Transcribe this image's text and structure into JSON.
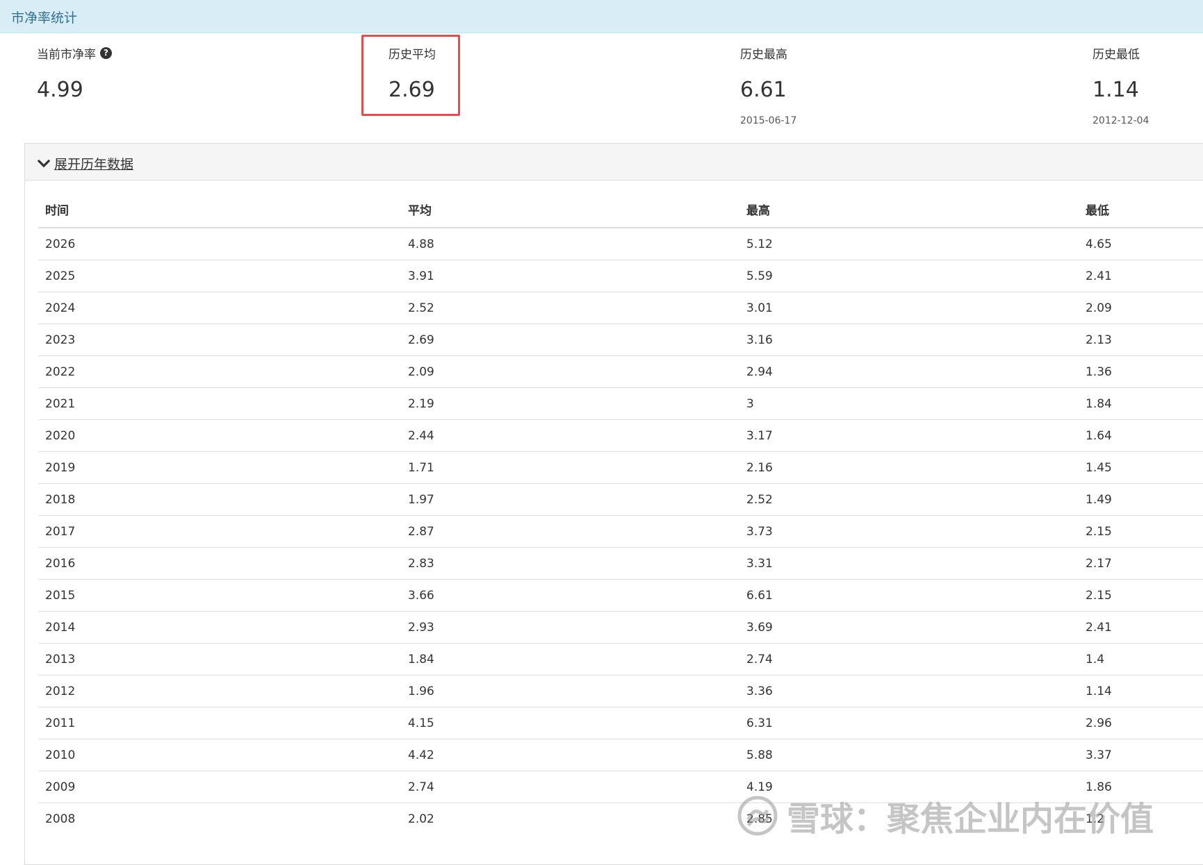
{
  "panel": {
    "title": "市净率统计"
  },
  "stats": {
    "current": {
      "label": "当前市净率",
      "value": "4.99"
    },
    "average": {
      "label": "历史平均",
      "value": "2.69"
    },
    "highest": {
      "label": "历史最高",
      "value": "6.61",
      "date": "2015-06-17"
    },
    "lowest": {
      "label": "历史最低",
      "value": "1.14",
      "date": "2012-12-04"
    }
  },
  "history": {
    "toggle_label": "展开历年数据",
    "columns": [
      "时间",
      "平均",
      "最高",
      "最低"
    ],
    "rows": [
      [
        "2026",
        "4.88",
        "5.12",
        "4.65"
      ],
      [
        "2025",
        "3.91",
        "5.59",
        "2.41"
      ],
      [
        "2024",
        "2.52",
        "3.01",
        "2.09"
      ],
      [
        "2023",
        "2.69",
        "3.16",
        "2.13"
      ],
      [
        "2022",
        "2.09",
        "2.94",
        "1.36"
      ],
      [
        "2021",
        "2.19",
        "3",
        "1.84"
      ],
      [
        "2020",
        "2.44",
        "3.17",
        "1.64"
      ],
      [
        "2019",
        "1.71",
        "2.16",
        "1.45"
      ],
      [
        "2018",
        "1.97",
        "2.52",
        "1.49"
      ],
      [
        "2017",
        "2.87",
        "3.73",
        "2.15"
      ],
      [
        "2016",
        "2.83",
        "3.31",
        "2.17"
      ],
      [
        "2015",
        "3.66",
        "6.61",
        "2.15"
      ],
      [
        "2014",
        "2.93",
        "3.69",
        "2.41"
      ],
      [
        "2013",
        "1.84",
        "2.74",
        "1.4"
      ],
      [
        "2012",
        "1.96",
        "3.36",
        "1.14"
      ],
      [
        "2011",
        "4.15",
        "6.31",
        "2.96"
      ],
      [
        "2010",
        "4.42",
        "5.88",
        "3.37"
      ],
      [
        "2009",
        "2.74",
        "4.19",
        "1.86"
      ],
      [
        "2008",
        "2.02",
        "2.85",
        "1.2"
      ]
    ]
  },
  "watermark": {
    "text": "雪球：聚焦企业内在价值"
  },
  "colors": {
    "highlight": "#e84b4b",
    "heading_bg": "#d9edf7",
    "heading_text": "#31708f"
  }
}
